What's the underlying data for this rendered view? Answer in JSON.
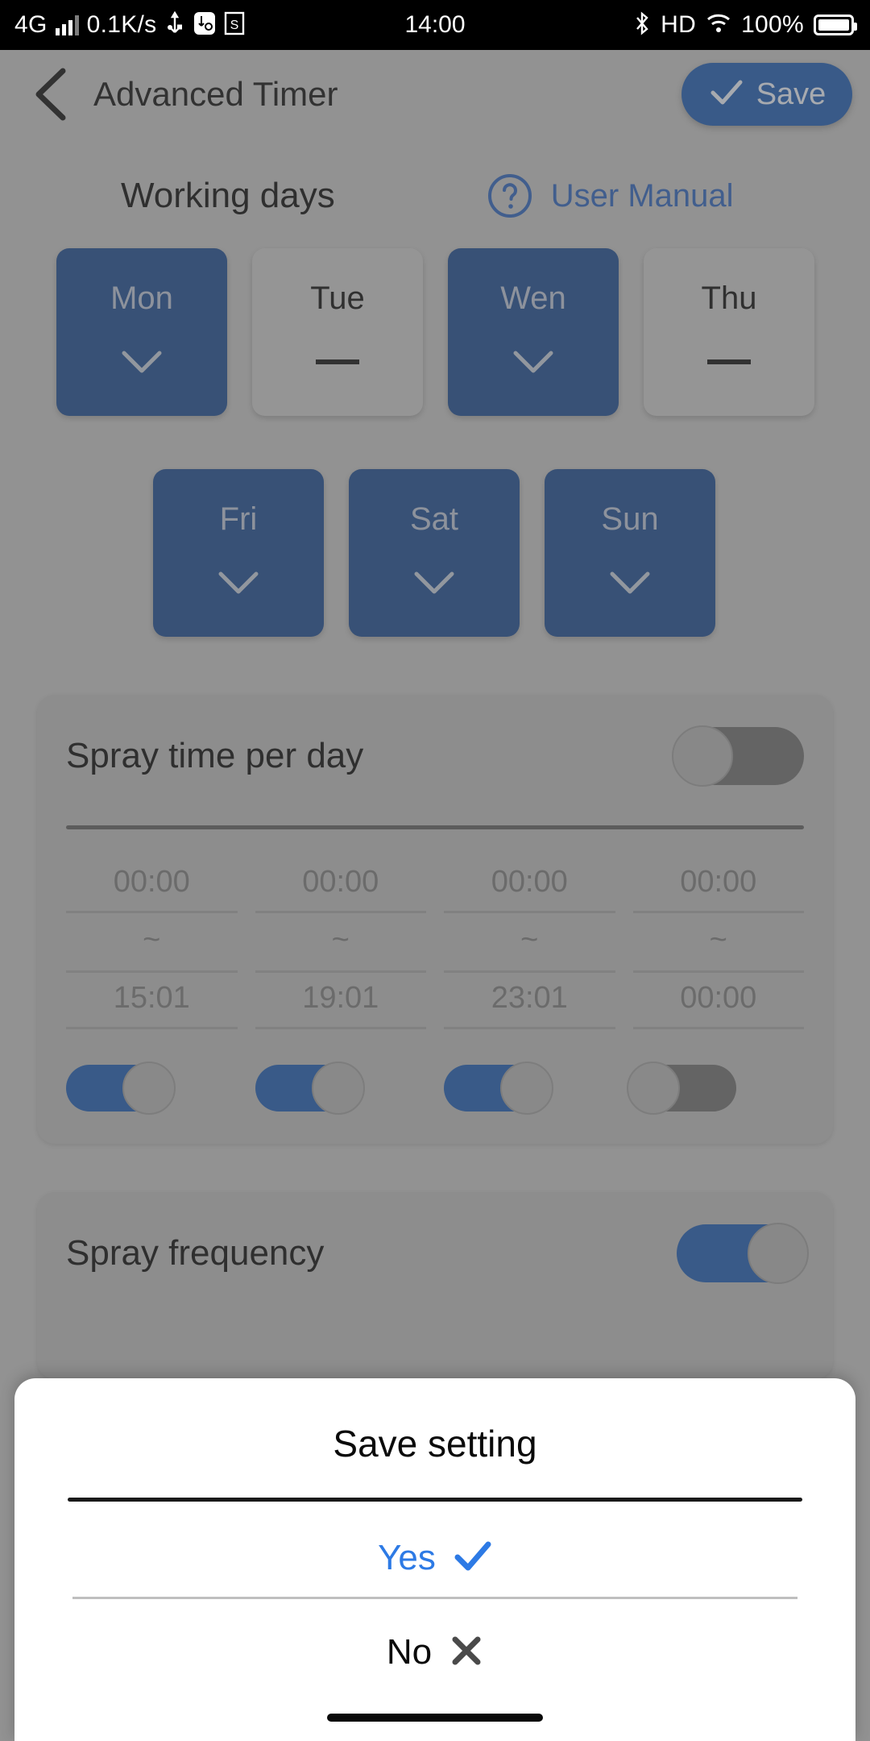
{
  "statusbar": {
    "network_type": "4G",
    "data_rate": "0.1K/s",
    "usb_icon": "usb-icon",
    "usb_debug_icon": "usb-debug-icon",
    "screenshot_icon": "screenshot-icon",
    "time": "14:00",
    "bluetooth_icon": "bluetooth-icon",
    "hd_label": "HD",
    "wifi_icon": "wifi-icon",
    "battery_percent": "100%"
  },
  "appbar": {
    "back_icon": "back-chevron-icon",
    "title": "Advanced Timer",
    "save_label": "Save",
    "save_check_icon": "check-icon"
  },
  "working_days": {
    "section_title": "Working days",
    "help_icon": "question-circle-icon",
    "manual_link": "User Manual",
    "row1": [
      {
        "label": "Mon",
        "selected": true,
        "mark": "✓"
      },
      {
        "label": "Tue",
        "selected": false,
        "mark": "—"
      },
      {
        "label": "Wen",
        "selected": true,
        "mark": "✓"
      },
      {
        "label": "Thu",
        "selected": false,
        "mark": "—"
      }
    ],
    "row2": [
      {
        "label": "Fri",
        "selected": true,
        "mark": "✓"
      },
      {
        "label": "Sat",
        "selected": true,
        "mark": "✓"
      },
      {
        "label": "Sun",
        "selected": true,
        "mark": "✓"
      }
    ]
  },
  "spray_time_card": {
    "title": "Spray time per day",
    "master_toggle_on": false,
    "separator": "~",
    "slots": [
      {
        "start": "00:00",
        "end": "15:01",
        "enabled": true
      },
      {
        "start": "00:00",
        "end": "19:01",
        "enabled": true
      },
      {
        "start": "00:00",
        "end": "23:01",
        "enabled": true
      },
      {
        "start": "00:00",
        "end": "00:00",
        "enabled": false
      }
    ]
  },
  "spray_frequency_card": {
    "title": "Spray frequency",
    "toggle_on": true
  },
  "dialog": {
    "title": "Save setting",
    "yes_label": "Yes",
    "yes_icon": "check-icon",
    "no_label": "No",
    "no_icon": "close-x-icon"
  },
  "colors": {
    "accent_blue": "#1f5cb0",
    "selected_day_blue": "#1d4b8f",
    "link_blue": "#2d63ba",
    "dialog_yes_blue": "#2d7ae5",
    "card_gray": "#b9b9b9",
    "page_gray": "#c2c2c2"
  }
}
